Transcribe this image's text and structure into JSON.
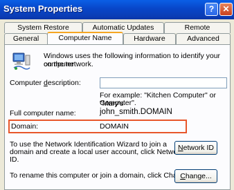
{
  "window": {
    "title": "System Properties",
    "help_glyph": "?",
    "close_glyph": "✕"
  },
  "tabs_row1": [
    "System Restore",
    "Automatic Updates",
    "Remote"
  ],
  "tabs_row2": [
    "General",
    "Computer Name",
    "Hardware",
    "Advanced"
  ],
  "active_tab": "Computer Name",
  "intro": {
    "line1": "Windows uses the following information to identify your computer",
    "line2": "on the network."
  },
  "description": {
    "label_pre": "Computer ",
    "label_underlined": "d",
    "label_post": "escription:",
    "value": "",
    "example_line1": "For example: \"Kitchen Computer\" or \"Mary's",
    "example_line2": "Computer\"."
  },
  "full_name": {
    "label": "Full computer name:",
    "value": "john_smith.DOMAIN"
  },
  "domain": {
    "label": "Domain:",
    "value": "DOMAIN"
  },
  "network_id": {
    "line1": "To use the Network Identification Wizard to join a",
    "line2": "domain and create a local user account, click Network",
    "line3": "ID.",
    "button_underlined": "N",
    "button_rest": "etwork ID"
  },
  "change": {
    "text": "To rename this computer or join a domain, click Change.",
    "button_underlined": "C",
    "button_rest": "hange..."
  },
  "colors": {
    "highlight_border": "#e8562a",
    "title_bar": "#0846c8",
    "active_tab_accent": "#f5a623"
  }
}
